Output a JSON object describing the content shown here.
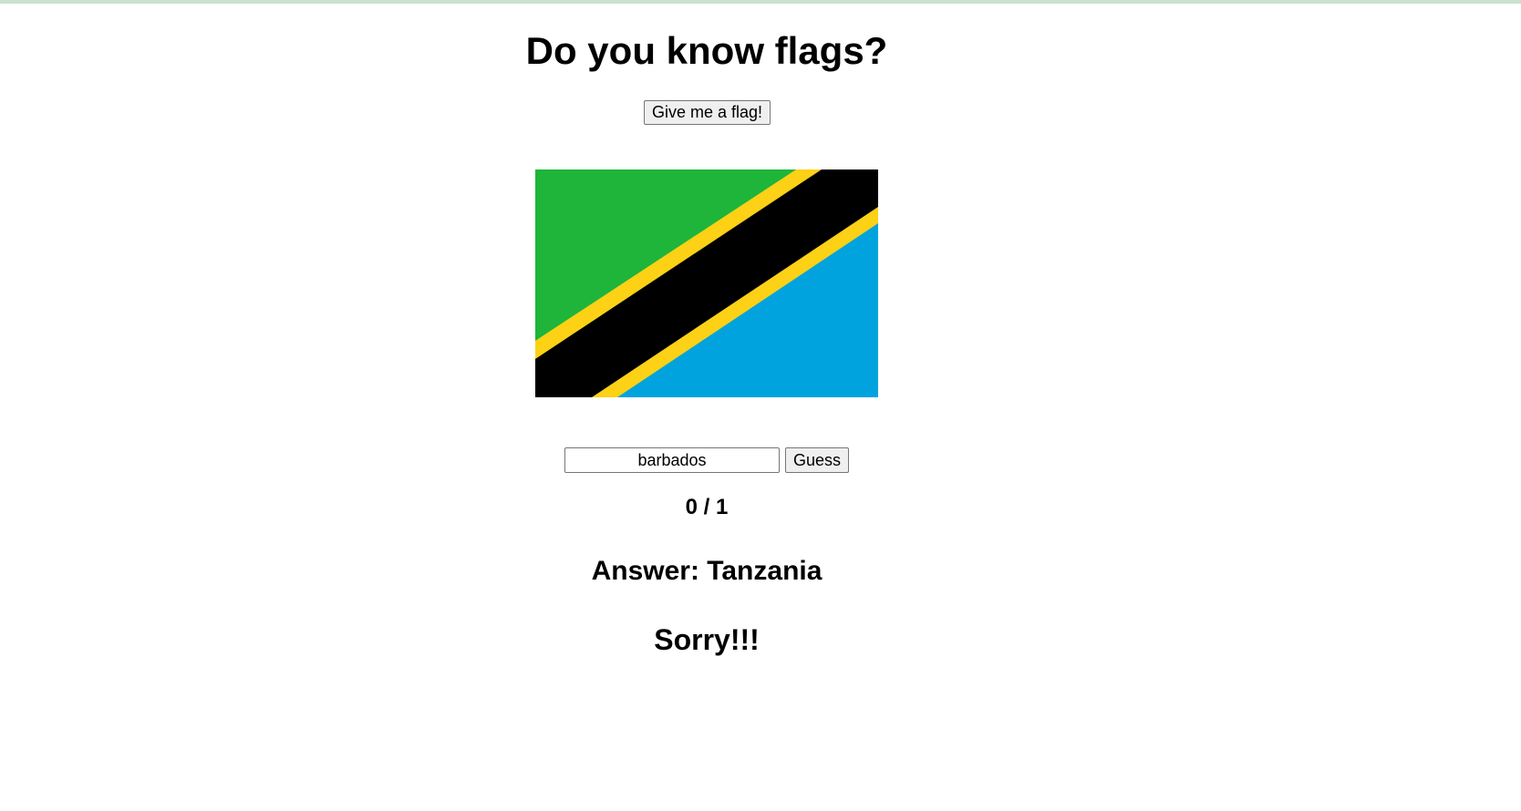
{
  "page": {
    "title": "Do you know flags?",
    "give_flag_label": "Give me a flag!",
    "guess_input_value": "barbados",
    "guess_label": "Guess",
    "score": "0 / 1",
    "answer": "Answer: Tanzania",
    "result": "Sorry!!!"
  },
  "flag": {
    "colors": {
      "green": "#1eb53a",
      "yellow": "#fcd116",
      "black": "#000000",
      "blue": "#00a3dd"
    }
  }
}
